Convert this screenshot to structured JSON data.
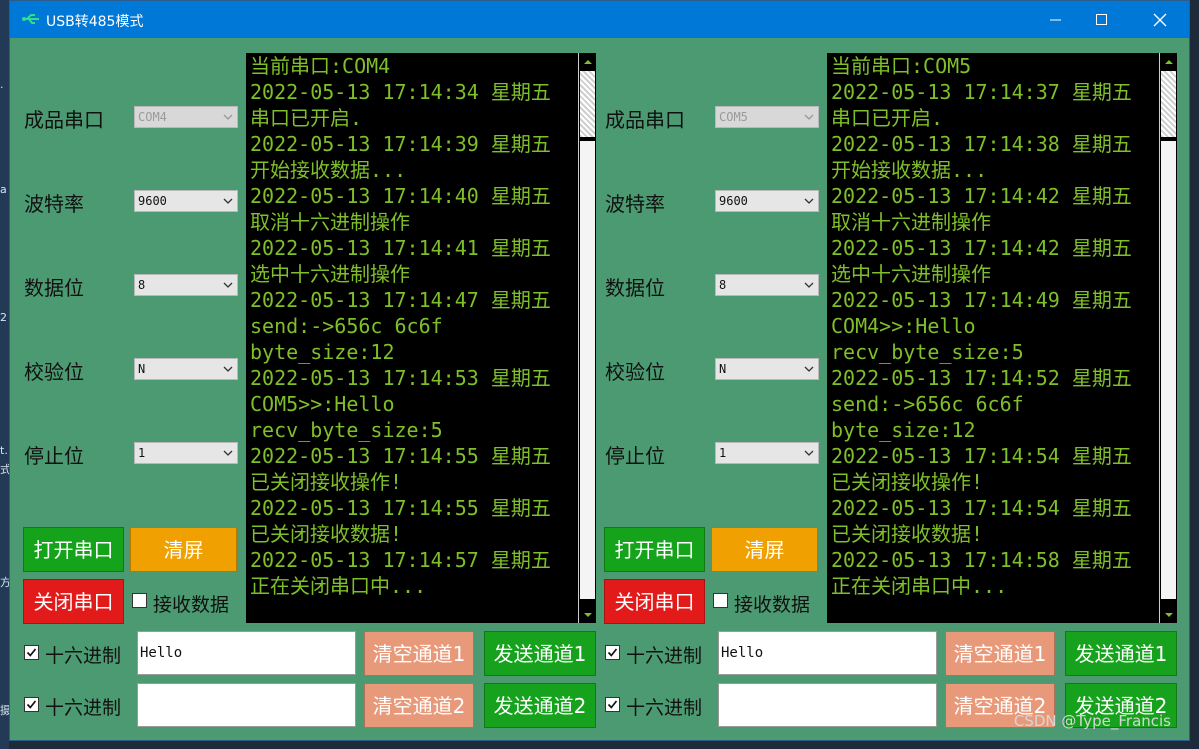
{
  "window": {
    "title": "USB转485模式",
    "buttons": [
      "minimize",
      "maximize",
      "close"
    ]
  },
  "desktop_edge_fragments": [
    ".",
    "a",
    "2",
    "t.",
    "式",
    "方",
    "摄"
  ],
  "labels": {
    "port": "成品串口",
    "baud": "波特率",
    "databits": "数据位",
    "parity": "校验位",
    "stopbits": "停止位"
  },
  "buttons": {
    "open": "打开串口",
    "clear": "清屏",
    "close": "关闭串口",
    "clear_ch1": "清空通道1",
    "send_ch1": "发送通道1",
    "clear_ch2": "清空通道2",
    "send_ch2": "发送通道2"
  },
  "checkboxes": {
    "receive": "接收数据",
    "hex": "十六进制"
  },
  "left": {
    "port": "COM4",
    "baud": "9600",
    "databits": "8",
    "parity": "N",
    "stopbits": "1",
    "receive_checked": false,
    "hex1_checked": true,
    "hex2_checked": true,
    "channel1": "Hello",
    "channel2": "",
    "log": [
      "当前串口:COM4",
      "2022-05-13 17:14:34 星期五",
      "串口已开启.",
      "2022-05-13 17:14:39 星期五",
      "开始接收数据...",
      "2022-05-13 17:14:40 星期五",
      "取消十六进制操作",
      "2022-05-13 17:14:41 星期五",
      "选中十六进制操作",
      "2022-05-13 17:14:47 星期五",
      "send:->656c 6c6f",
      "byte_size:12",
      "2022-05-13 17:14:53 星期五",
      "COM5>>:Hello",
      "recv_byte_size:5",
      "2022-05-13 17:14:55 星期五",
      "已关闭接收操作!",
      "2022-05-13 17:14:55 星期五",
      "已关闭接收数据!",
      "2022-05-13 17:14:57 星期五",
      "正在关闭串口中..."
    ]
  },
  "right": {
    "port": "COM5",
    "baud": "9600",
    "databits": "8",
    "parity": "N",
    "stopbits": "1",
    "receive_checked": false,
    "hex1_checked": true,
    "hex2_checked": true,
    "channel1": "Hello",
    "channel2": "",
    "log": [
      "当前串口:COM5",
      "2022-05-13 17:14:37 星期五",
      "串口已开启.",
      "2022-05-13 17:14:38 星期五",
      "开始接收数据...",
      "2022-05-13 17:14:42 星期五",
      "取消十六进制操作",
      "2022-05-13 17:14:42 星期五",
      "选中十六进制操作",
      "2022-05-13 17:14:49 星期五",
      "COM4>>:Hello",
      "recv_byte_size:5",
      "2022-05-13 17:14:52 星期五",
      "send:->656c 6c6f",
      "byte_size:12",
      "2022-05-13 17:14:54 星期五",
      "已关闭接收操作!",
      "2022-05-13 17:14:54 星期五",
      "已关闭接收数据!",
      "2022-05-13 17:14:58 星期五",
      "正在关闭串口中..."
    ]
  },
  "watermark": "CSDN @Type_Francis",
  "colors": {
    "window_bg": "#4b9a72",
    "titlebar": "#0078d7",
    "console_text": "#7fbf2a",
    "open_btn": "#16a31c",
    "clear_btn": "#f0a000",
    "close_btn": "#e21a1a",
    "clear_channel_btn": "#e8997a",
    "send_channel_btn": "#17a21d"
  }
}
